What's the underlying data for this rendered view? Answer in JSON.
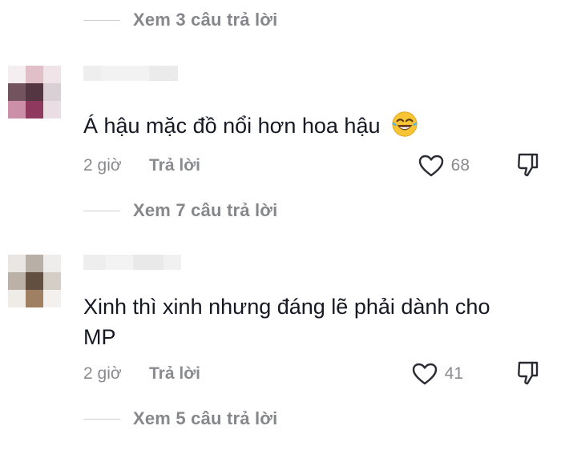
{
  "replies_top": {
    "label": "Xem 3 câu trả lời"
  },
  "comments": [
    {
      "text": "Á hậu mặc đồ nổi hơn hoa hậu",
      "emoji": "laughing-tears-emoji",
      "time": "2 giờ",
      "reply_label": "Trả lời",
      "likes": "68",
      "view_replies": "Xem 7 câu trả lời"
    },
    {
      "text_line1": "Xinh thì xinh nhưng đáng lẽ phải dành cho",
      "text_line2": "MP",
      "time": "2 giờ",
      "reply_label": "Trả lời",
      "likes": "41",
      "view_replies": "Xem 5 câu trả lời"
    }
  ],
  "icons": {
    "like": "heart-outline-icon",
    "dislike": "thumbs-down-icon"
  },
  "colors": {
    "text_primary": "#161823",
    "text_secondary": "#8a8b91"
  }
}
